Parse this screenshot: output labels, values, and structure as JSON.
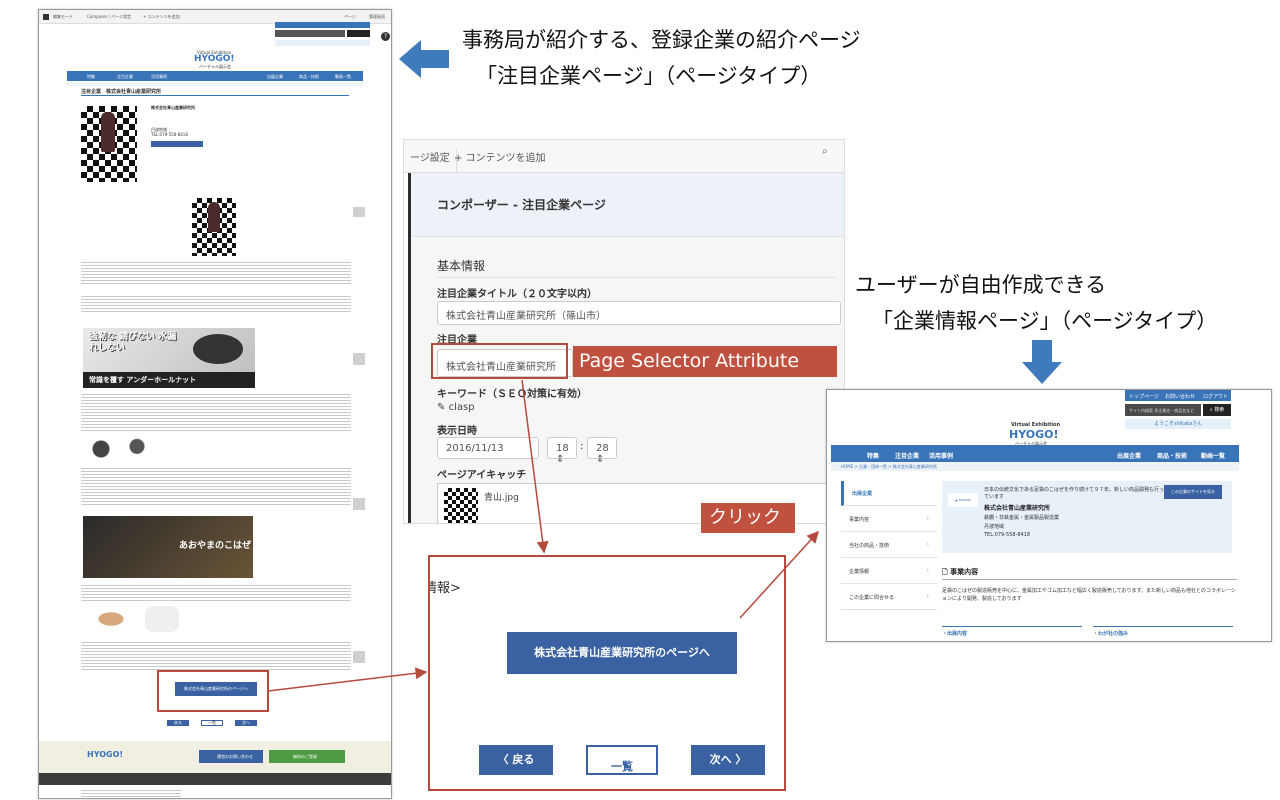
{
  "callouts": {
    "top_line1": "事務局が紹介する、登録企業の紹介ページ",
    "top_line2": "「注目企業ページ」（ページタイプ）",
    "right_line1": "ユーザーが自由作成できる",
    "right_line2": "「企業情報ページ」（ページタイプ）",
    "page_selector": "Page Selector Attribute",
    "click": "クリック"
  },
  "left_page": {
    "toolbar": [
      "編集モード",
      "Composer / ページ設定",
      "+ コンテンツを追加",
      "ページ",
      "管理画面"
    ],
    "logo_top": "Virtual Exhibition",
    "logo_main": "HYOGO!",
    "logo_sub": "バーチャル展示会",
    "nav": [
      "特集",
      "注目企業",
      "活用事例",
      "出展企業",
      "商品・技術",
      "動画一覧"
    ],
    "page_heading": "注目企業　株式会社青山産業研究所",
    "company_name": "株式会社青山産業研究所",
    "company_area": "丹波地域",
    "company_tel": "TEL:079-558-8418",
    "banner1": "強靭な 錆びない 水漏れしない",
    "banner1_caption": "常識を覆す アンダーホールナット",
    "banner2": "あおやまのこはぜ",
    "link_button": "株式会社青山産業研究所のページへ",
    "pager": [
      "戻る",
      "一覧",
      "次へ"
    ],
    "footer_btn1": "運営のお問い合わせ",
    "footer_btn2": "無料のご登録"
  },
  "composer": {
    "tab_settings": "ージ設定",
    "tab_add": "+ コンテンツを追加",
    "search_icon_char": "🔍",
    "title": "コンポーザー - 注目企業ページ",
    "section": "基本情報",
    "field_title_label": "注目企業タイトル（２０文字以内）",
    "field_title_value": "株式会社青山産業研究所（篠山市）",
    "field_company_label": "注目企業",
    "field_company_value": "株式会社青山産業研究所",
    "field_keyword_label": "キーワード（ＳＥＯ対策に有効）",
    "field_keyword_value": "clasp",
    "field_date_label": "表示日時",
    "field_date_value": "2016/11/13",
    "field_hour": "18",
    "field_minute": "28",
    "field_eyecatch_label": "ページアイキャッチ",
    "eyecatch_file": "青山.jpg"
  },
  "zoom": {
    "partial_text": "情報>",
    "page_button": "株式会社青山産業研究所のページへ",
    "back": "〈 戻る",
    "list": "一覧",
    "next": "次へ 〉"
  },
  "right_page": {
    "top_links": [
      "トップページ",
      "お問い合わせ",
      "ログアウト"
    ],
    "search_placeholder": "サイト内検索 多企業名・商品名など",
    "search_button": "検索",
    "welcome": "ようこそshikataさん",
    "logo_top": "Virtual Exhibition",
    "logo_main": "HYOGO!",
    "logo_sub": "バーチャル展示会",
    "tagline": "兵庫県の元気な企業を組織発的にマッチング",
    "nav": [
      "特集",
      "注目企業",
      "活用事例",
      "出展企業",
      "商品・技術",
      "動画一覧"
    ],
    "breadcrumb": "HOME > 企業・団体一覧 > 株式会社青山産業研究所",
    "side": [
      "出展企業",
      "事業内容",
      "当社の商品・技術",
      "企業情報",
      "この企業に問合せる"
    ],
    "intro": "日本の伝統文化である足袋のこはぜを作り続けて９７年。新しい商品開発も行っています",
    "company_name": "株式会社青山産業研究所",
    "industry": "鉄鋼・非鉄金属・金属製品製造業",
    "area": "丹波地域",
    "tel": "TEL:079-558-8418",
    "site_button": "この企業のサイトを見る",
    "section_title": "事業内容",
    "section_text": "足袋のこはぜの製造販売を中心に、金属加工やゴム加工など幅広く製造販売しております。また新しい商品も他社とのコラボレーションにより開発、製造しております",
    "sub1": "出展内容",
    "sub2": "わが社の強み"
  }
}
